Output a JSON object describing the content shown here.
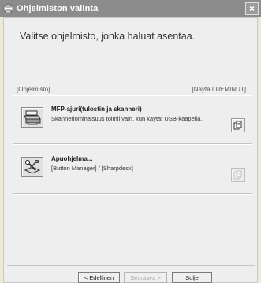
{
  "window": {
    "title": "Ohjelmiston valinta",
    "close_label": "×"
  },
  "main": {
    "heading": "Valitse ohjelmisto, jonka haluat asentaa.",
    "column_left": "[Ohjelmisto]",
    "column_right": "[Näytä LUEMINUT]"
  },
  "items": [
    {
      "title": "MFP-ajuri(tulostin ja skanneri)",
      "description": "Skanneriominaisuus toimii vain, kun käytät USB-kaapelia.",
      "icon": "printer-scanner-icon",
      "readme_enabled": true
    },
    {
      "title": "Apuohjelma...",
      "description": "[Button Manager] / [Sharpdesk]",
      "icon": "utility-tools-icon",
      "readme_enabled": false
    }
  ],
  "footer": {
    "back_label": "< Edellinen",
    "next_label": "Seuraava >",
    "close_label": "Sulje"
  },
  "colors": {
    "titlebar": "#8c8c8c",
    "background": "#eeeeee"
  }
}
